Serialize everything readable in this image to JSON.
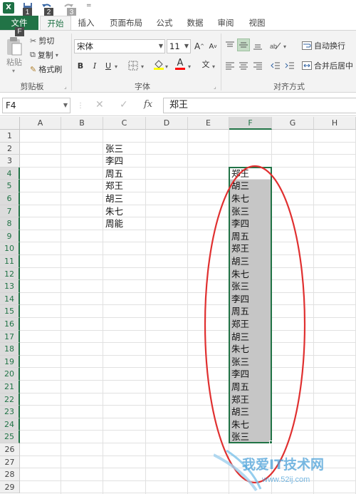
{
  "quick_access": {
    "keytips": [
      "1",
      "2",
      "3"
    ],
    "overflow": "="
  },
  "tabs": [
    {
      "label": "文件"
    },
    {
      "label": "开始"
    },
    {
      "label": "插入"
    },
    {
      "label": "页面布局"
    },
    {
      "label": "公式"
    },
    {
      "label": "数据"
    },
    {
      "label": "审阅"
    },
    {
      "label": "视图"
    }
  ],
  "file_keytip": "F",
  "ribbon": {
    "clipboard": {
      "paste_label": "粘贴",
      "cut_label": "剪切",
      "copy_label": "复制",
      "format_painter_label": "格式刷",
      "group_label": "剪贴板"
    },
    "font": {
      "font_name": "宋体",
      "font_size": "11",
      "bold": "B",
      "italic": "I",
      "underline": "U",
      "font_color_letter": "A",
      "font_color": "#ff0000",
      "highlight_color": "#ffff00",
      "wen": "文",
      "grow": "A",
      "shrink": "A",
      "group_label": "字体"
    },
    "alignment": {
      "wrap_text_label": "自动换行",
      "merge_center_label": "合并后居中",
      "group_label": "对齐方式"
    }
  },
  "formula_bar": {
    "name_box": "F4",
    "fx": "fx",
    "value": "郑王"
  },
  "grid": {
    "columns": [
      "A",
      "B",
      "C",
      "D",
      "E",
      "F",
      "G",
      "H"
    ],
    "selected_column": "F",
    "rows": [
      "1",
      "2",
      "3",
      "4",
      "5",
      "6",
      "7",
      "8",
      "9",
      "10",
      "11",
      "12",
      "13",
      "14",
      "15",
      "16",
      "17",
      "18",
      "19",
      "20",
      "21",
      "22",
      "23",
      "24",
      "25",
      "26",
      "27",
      "28",
      "29"
    ],
    "column_c_values": [
      "",
      "张三",
      "李四",
      "周五",
      "郑王",
      "胡三",
      "朱七",
      "周能"
    ],
    "column_f_values": [
      "",
      "",
      "",
      "郑王",
      "胡三",
      "朱七",
      "张三",
      "李四",
      "周五",
      "郑王",
      "胡三",
      "朱七",
      "张三",
      "李四",
      "周五",
      "郑王",
      "胡三",
      "朱七",
      "张三",
      "李四",
      "周五",
      "郑王",
      "胡三",
      "朱七",
      "张三"
    ],
    "selection": "F4:F25"
  },
  "colors": {
    "excel_green": "#217346",
    "annotation_red": "#e03030",
    "selection_fill": "#c6c6c6"
  },
  "watermark": {
    "text": "我爱IT技术网",
    "url": "www.52ij.com"
  }
}
